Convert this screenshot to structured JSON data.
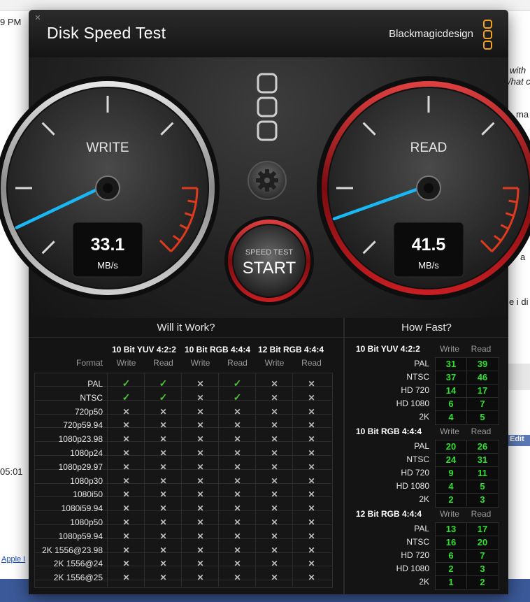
{
  "background": {
    "time_top": "9 PM",
    "time_mid": "05:01",
    "snip_with": "with",
    "snip_what": "/hat c",
    "snip_ma": "ma",
    "snip_la": "a",
    "snip_ie": "e i di",
    "edit_label": "Edit",
    "apple_link": "Apple I"
  },
  "window": {
    "title": "Disk Speed Test",
    "brand": "Blackmagicdesign"
  },
  "write_gauge": {
    "label": "WRITE",
    "value": "33.1",
    "unit": "MB/s"
  },
  "read_gauge": {
    "label": "READ",
    "value": "41.5",
    "unit": "MB/s"
  },
  "start_button": {
    "small": "SPEED TEST",
    "big": "START"
  },
  "will_it_work": {
    "title": "Will it Work?",
    "format_label": "Format",
    "groups": [
      {
        "name": "10 Bit YUV 4:2:2",
        "write": "Write",
        "read": "Read"
      },
      {
        "name": "10 Bit RGB 4:4:4",
        "write": "Write",
        "read": "Read"
      },
      {
        "name": "12 Bit RGB 4:4:4",
        "write": "Write",
        "read": "Read"
      }
    ],
    "rows": [
      {
        "format": "PAL",
        "marks": [
          1,
          1,
          0,
          1,
          0,
          0
        ]
      },
      {
        "format": "NTSC",
        "marks": [
          1,
          1,
          0,
          1,
          0,
          0
        ]
      },
      {
        "format": "720p50",
        "marks": [
          0,
          0,
          0,
          0,
          0,
          0
        ]
      },
      {
        "format": "720p59.94",
        "marks": [
          0,
          0,
          0,
          0,
          0,
          0
        ]
      },
      {
        "format": "1080p23.98",
        "marks": [
          0,
          0,
          0,
          0,
          0,
          0
        ]
      },
      {
        "format": "1080p24",
        "marks": [
          0,
          0,
          0,
          0,
          0,
          0
        ]
      },
      {
        "format": "1080p29.97",
        "marks": [
          0,
          0,
          0,
          0,
          0,
          0
        ]
      },
      {
        "format": "1080p30",
        "marks": [
          0,
          0,
          0,
          0,
          0,
          0
        ]
      },
      {
        "format": "1080i50",
        "marks": [
          0,
          0,
          0,
          0,
          0,
          0
        ]
      },
      {
        "format": "1080i59.94",
        "marks": [
          0,
          0,
          0,
          0,
          0,
          0
        ]
      },
      {
        "format": "1080p50",
        "marks": [
          0,
          0,
          0,
          0,
          0,
          0
        ]
      },
      {
        "format": "1080p59.94",
        "marks": [
          0,
          0,
          0,
          0,
          0,
          0
        ]
      },
      {
        "format": "2K 1556@23.98",
        "marks": [
          0,
          0,
          0,
          0,
          0,
          0
        ]
      },
      {
        "format": "2K 1556@24",
        "marks": [
          0,
          0,
          0,
          0,
          0,
          0
        ]
      },
      {
        "format": "2K 1556@25",
        "marks": [
          0,
          0,
          0,
          0,
          0,
          0
        ]
      }
    ]
  },
  "how_fast": {
    "title": "How Fast?",
    "sections": [
      {
        "name": "10 Bit YUV 4:2:2",
        "write": "Write",
        "read": "Read",
        "rows": [
          {
            "label": "PAL",
            "w": "31",
            "r": "39"
          },
          {
            "label": "NTSC",
            "w": "37",
            "r": "46"
          },
          {
            "label": "HD 720",
            "w": "14",
            "r": "17"
          },
          {
            "label": "HD 1080",
            "w": "6",
            "r": "7"
          },
          {
            "label": "2K",
            "w": "4",
            "r": "5"
          }
        ]
      },
      {
        "name": "10 Bit RGB 4:4:4",
        "write": "Write",
        "read": "Read",
        "rows": [
          {
            "label": "PAL",
            "w": "20",
            "r": "26"
          },
          {
            "label": "NTSC",
            "w": "24",
            "r": "31"
          },
          {
            "label": "HD 720",
            "w": "9",
            "r": "11"
          },
          {
            "label": "HD 1080",
            "w": "4",
            "r": "5"
          },
          {
            "label": "2K",
            "w": "2",
            "r": "3"
          }
        ]
      },
      {
        "name": "12 Bit RGB 4:4:4",
        "write": "Write",
        "read": "Read",
        "rows": [
          {
            "label": "PAL",
            "w": "13",
            "r": "17"
          },
          {
            "label": "NTSC",
            "w": "16",
            "r": "20"
          },
          {
            "label": "HD 720",
            "w": "6",
            "r": "7"
          },
          {
            "label": "HD 1080",
            "w": "2",
            "r": "3"
          },
          {
            "label": "2K",
            "w": "1",
            "r": "2"
          }
        ]
      }
    ]
  },
  "colors": {
    "check": "#52c23a",
    "number": "#2ee02e",
    "needle": "#19b8f5",
    "red_zone": "#e03a1e",
    "read_ring": "#b4161b"
  }
}
